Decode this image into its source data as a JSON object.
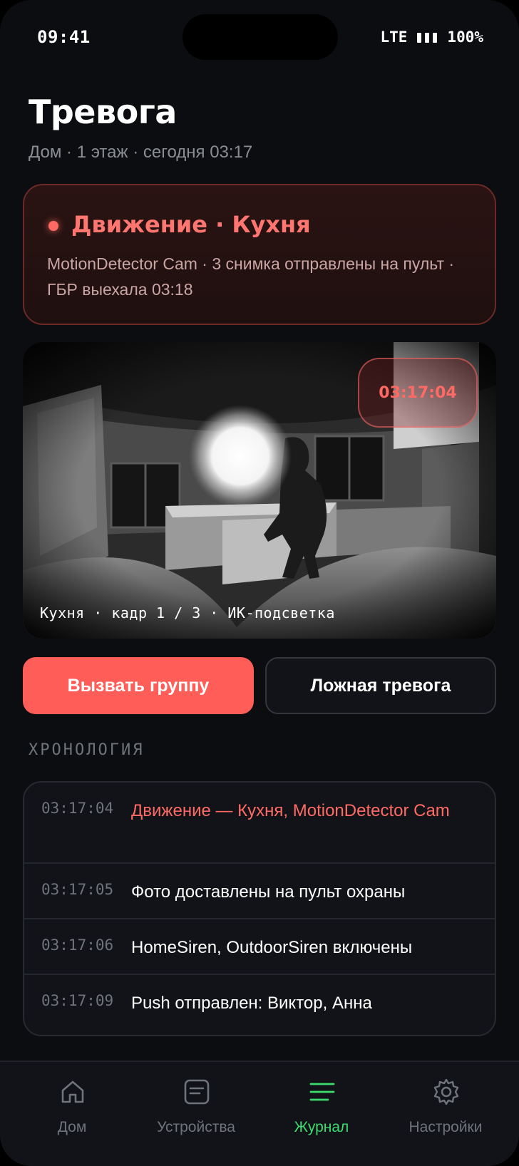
{
  "status_bar": {
    "time": "09:41",
    "network": "LTE",
    "battery": "100%"
  },
  "header": {
    "title": "Тревога",
    "subtitle": "Дом · 1 этаж · сегодня 03:17"
  },
  "alert": {
    "title": "Движение · Кухня",
    "description": "MotionDetector Cam · 3 снимка отправлены на пульт · ГБР выехала 03:18",
    "color": "#ff6b64"
  },
  "camera": {
    "timestamp": "03:17:04",
    "caption": "Кухня · кадр 1 / 3 · ИК-подсветка"
  },
  "actions": {
    "call_label": "Вызвать группу",
    "false_alarm_label": "Ложная тревога"
  },
  "timeline": {
    "title": "ХРОНОЛОГИЯ",
    "events": [
      {
        "time": "03:17:04",
        "text": "Движение — Кухня, MotionDetector Cam",
        "alert": true
      },
      {
        "time": "03:17:05",
        "text": "Фото доставлены на пульт охраны",
        "alert": false
      },
      {
        "time": "03:17:06",
        "text": "HomeSiren, OutdoorSiren включены",
        "alert": false
      },
      {
        "time": "03:17:09",
        "text": "Push отправлен: Виктор, Анна",
        "alert": false
      }
    ]
  },
  "nav": {
    "items": [
      {
        "label": "Дом",
        "icon": "home-icon",
        "active": false
      },
      {
        "label": "Устройства",
        "icon": "devices-icon",
        "active": false
      },
      {
        "label": "Журнал",
        "icon": "journal-icon",
        "active": true
      },
      {
        "label": "Настройки",
        "icon": "gear-icon",
        "active": false
      }
    ],
    "active_color": "#3ddc6e"
  }
}
